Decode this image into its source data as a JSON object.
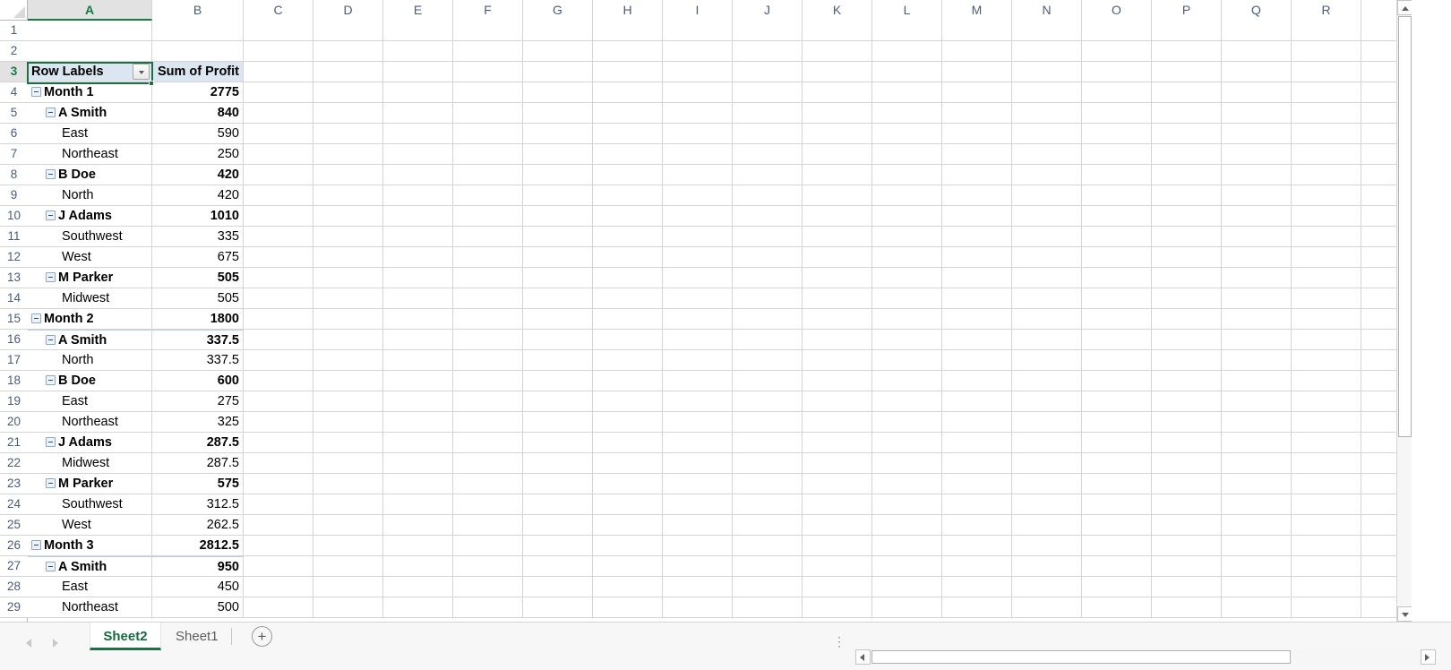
{
  "spreadsheet": {
    "active_cell": "A3",
    "column_letters": [
      "A",
      "B",
      "C",
      "D",
      "E",
      "F",
      "G",
      "H",
      "I",
      "J",
      "K",
      "L",
      "M",
      "N",
      "O",
      "P",
      "Q",
      "R"
    ],
    "selected_column": "A",
    "selected_row": 3,
    "first_row_number": 1,
    "visible_row_numbers": [
      1,
      2,
      3,
      4,
      5,
      6,
      7,
      8,
      9,
      10,
      11,
      12,
      13,
      14,
      15,
      16,
      17,
      18,
      19,
      20,
      21,
      22,
      23,
      24,
      25,
      26,
      27,
      28,
      29
    ]
  },
  "pivot": {
    "header_row": 3,
    "row_labels_header": "Row Labels",
    "value_header": "Sum of Profit",
    "rows": [
      {
        "row": 4,
        "level": 0,
        "label": "Month 1",
        "value": "2775",
        "toggle": true,
        "bold": true,
        "group_start": false
      },
      {
        "row": 5,
        "level": 1,
        "label": "A Smith",
        "value": "840",
        "toggle": true,
        "bold": true,
        "group_start": false
      },
      {
        "row": 6,
        "level": 2,
        "label": "East",
        "value": "590",
        "toggle": false,
        "bold": false,
        "group_start": false
      },
      {
        "row": 7,
        "level": 2,
        "label": "Northeast",
        "value": "250",
        "toggle": false,
        "bold": false,
        "group_start": false
      },
      {
        "row": 8,
        "level": 1,
        "label": "B Doe",
        "value": "420",
        "toggle": true,
        "bold": true,
        "group_start": false
      },
      {
        "row": 9,
        "level": 2,
        "label": "North",
        "value": "420",
        "toggle": false,
        "bold": false,
        "group_start": false
      },
      {
        "row": 10,
        "level": 1,
        "label": "J Adams",
        "value": "1010",
        "toggle": true,
        "bold": true,
        "group_start": false
      },
      {
        "row": 11,
        "level": 2,
        "label": "Southwest",
        "value": "335",
        "toggle": false,
        "bold": false,
        "group_start": false
      },
      {
        "row": 12,
        "level": 2,
        "label": "West",
        "value": "675",
        "toggle": false,
        "bold": false,
        "group_start": false
      },
      {
        "row": 13,
        "level": 1,
        "label": "M Parker",
        "value": "505",
        "toggle": true,
        "bold": true,
        "group_start": false
      },
      {
        "row": 14,
        "level": 2,
        "label": "Midwest",
        "value": "505",
        "toggle": false,
        "bold": false,
        "group_start": false
      },
      {
        "row": 15,
        "level": 0,
        "label": "Month 2",
        "value": "1800",
        "toggle": true,
        "bold": true,
        "group_start": false
      },
      {
        "row": 16,
        "level": 1,
        "label": "A Smith",
        "value": "337.5",
        "toggle": true,
        "bold": true,
        "group_start": true
      },
      {
        "row": 17,
        "level": 2,
        "label": "North",
        "value": "337.5",
        "toggle": false,
        "bold": false,
        "group_start": false
      },
      {
        "row": 18,
        "level": 1,
        "label": "B Doe",
        "value": "600",
        "toggle": true,
        "bold": true,
        "group_start": false
      },
      {
        "row": 19,
        "level": 2,
        "label": "East",
        "value": "275",
        "toggle": false,
        "bold": false,
        "group_start": false
      },
      {
        "row": 20,
        "level": 2,
        "label": "Northeast",
        "value": "325",
        "toggle": false,
        "bold": false,
        "group_start": false
      },
      {
        "row": 21,
        "level": 1,
        "label": "J Adams",
        "value": "287.5",
        "toggle": true,
        "bold": true,
        "group_start": false
      },
      {
        "row": 22,
        "level": 2,
        "label": "Midwest",
        "value": "287.5",
        "toggle": false,
        "bold": false,
        "group_start": false
      },
      {
        "row": 23,
        "level": 1,
        "label": "M Parker",
        "value": "575",
        "toggle": true,
        "bold": true,
        "group_start": false
      },
      {
        "row": 24,
        "level": 2,
        "label": "Southwest",
        "value": "312.5",
        "toggle": false,
        "bold": false,
        "group_start": false
      },
      {
        "row": 25,
        "level": 2,
        "label": "West",
        "value": "262.5",
        "toggle": false,
        "bold": false,
        "group_start": false
      },
      {
        "row": 26,
        "level": 0,
        "label": "Month 3",
        "value": "2812.5",
        "toggle": true,
        "bold": true,
        "group_start": false
      },
      {
        "row": 27,
        "level": 1,
        "label": "A Smith",
        "value": "950",
        "toggle": true,
        "bold": true,
        "group_start": true
      },
      {
        "row": 28,
        "level": 2,
        "label": "East",
        "value": "450",
        "toggle": false,
        "bold": false,
        "group_start": false
      },
      {
        "row": 29,
        "level": 2,
        "label": "Northeast",
        "value": "500",
        "toggle": false,
        "bold": false,
        "group_start": false
      }
    ]
  },
  "tabs": {
    "sheets": [
      {
        "name": "Sheet2",
        "active": true
      },
      {
        "name": "Sheet1",
        "active": false
      }
    ],
    "add_sheet_label": "+",
    "menu_dots": "⋮"
  },
  "colors": {
    "accent_green": "#1d7044",
    "pivot_header_fill": "#dce6f1",
    "gridline": "#d4d4d4",
    "header_selected_fill": "#e2e2e2"
  }
}
